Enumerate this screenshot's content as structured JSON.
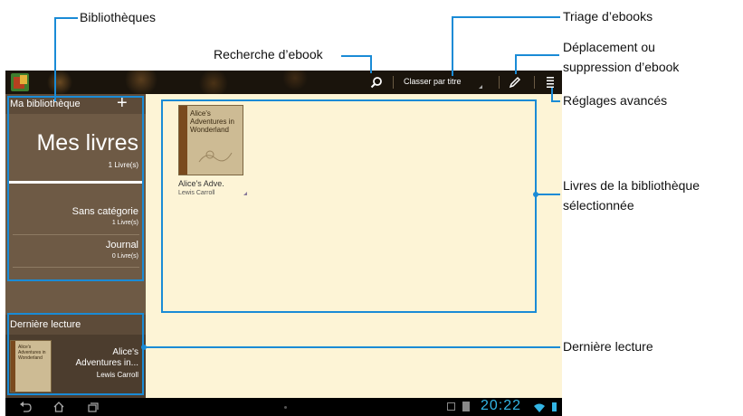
{
  "callouts": {
    "bibliotheques": "Bibliothèques",
    "recherche": "Recherche d’ebook",
    "triage": "Triage d’ebooks",
    "deplacement_1": "Déplacement ou",
    "deplacement_2": "suppression d’ebook",
    "reglages": "Réglages avancés",
    "livres_1": "Livres de la bibliothèque",
    "livres_2": "sélectionnée",
    "derniere": "Dernière lecture"
  },
  "toolbar": {
    "sort_label": "Classer par titre"
  },
  "sidebar": {
    "library_title": "Ma bibliothèque",
    "add_symbol": "+",
    "main": {
      "title": "Mes livres",
      "count": "1 Livre(s)"
    },
    "items": [
      {
        "title": "Sans catégorie",
        "count": "1 Livre(s)"
      },
      {
        "title": "Journal",
        "count": "0 Livre(s)"
      }
    ],
    "recent_header": "Dernière lecture",
    "recent_book": {
      "cover": "Alice's Adventures in Wonderland",
      "title_1": "Alice's",
      "title_2": "Adventures in...",
      "author": "Lewis Carroll"
    }
  },
  "content": {
    "books": [
      {
        "cover": "Alice's Adventures in Wonderland",
        "title": "Alice's Adve.",
        "author": "Lewis Carroll"
      }
    ]
  },
  "status": {
    "time": "20:22"
  },
  "colors": {
    "accent": "#1a8bd6",
    "sidebar": "#6e5a45",
    "content_bg": "#fdf4d6"
  }
}
